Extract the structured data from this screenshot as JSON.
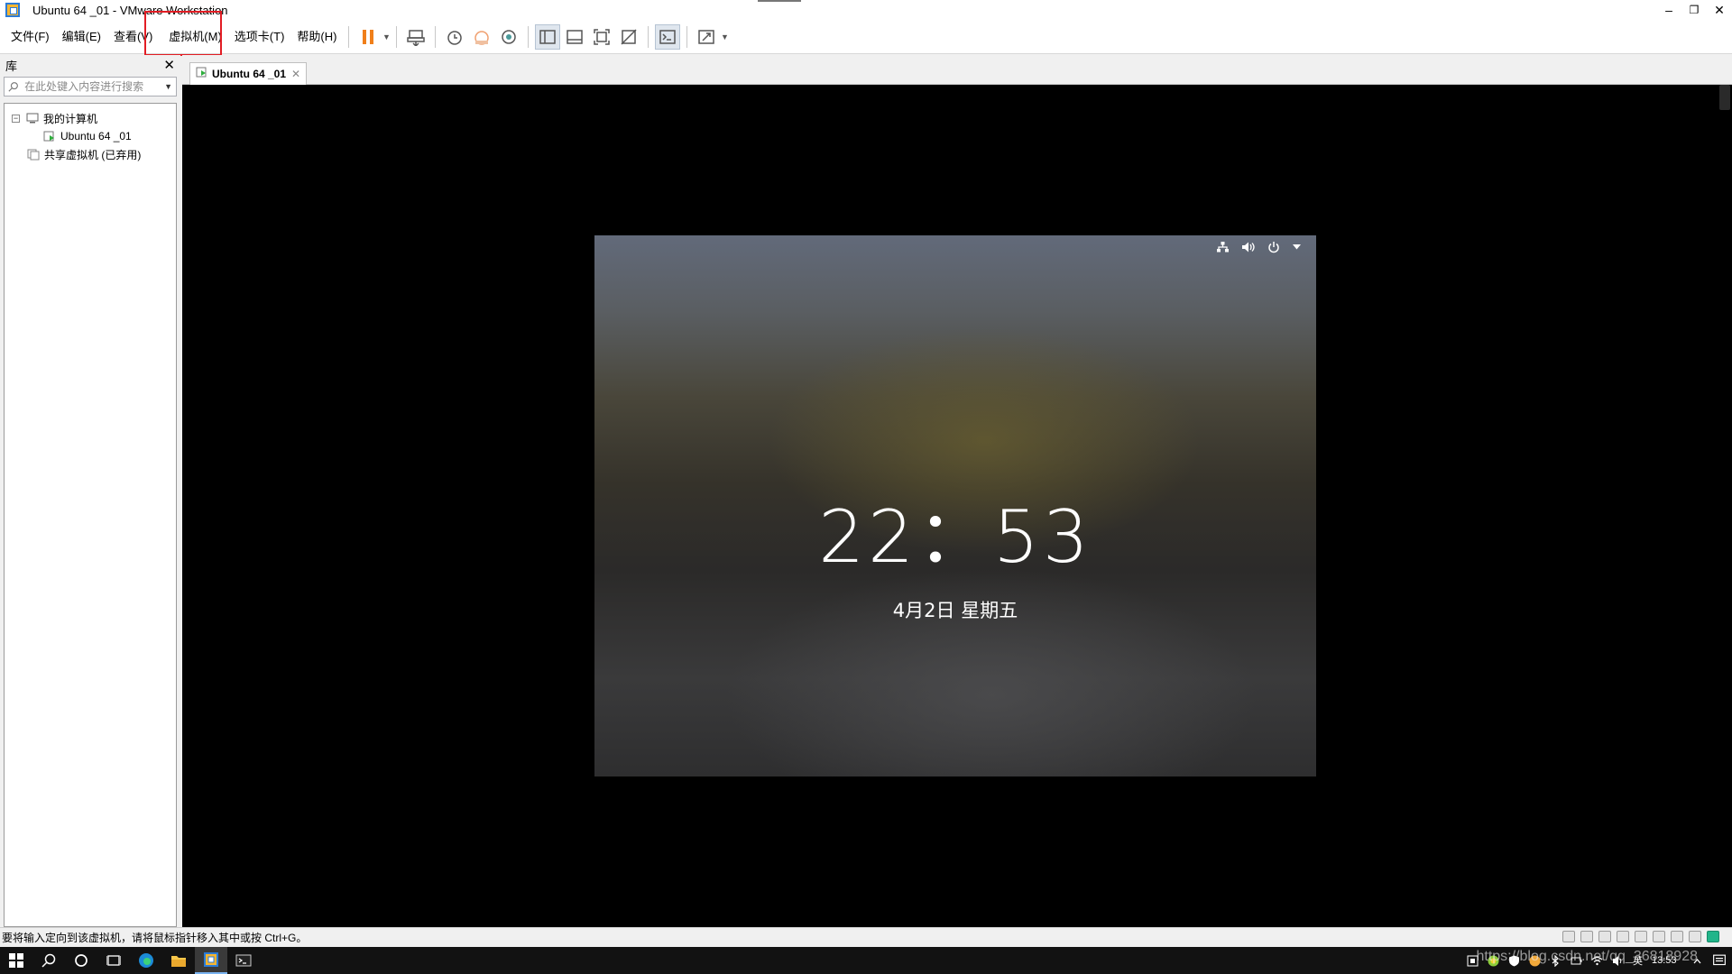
{
  "window": {
    "title": "Ubuntu 64 _01 - VMware Workstation",
    "controls": [
      "–",
      "❐",
      "✕"
    ]
  },
  "menu": {
    "items": [
      "文件(F)",
      "编辑(E)",
      "查看(V)",
      "虚拟机(M)",
      "选项卡(T)",
      "帮助(H)"
    ],
    "highlighted": "虚拟机(M)"
  },
  "library": {
    "title": "库",
    "close": "✕",
    "search_placeholder": "在此处键入内容进行搜索",
    "tree": {
      "expander": "−",
      "my_computer": "我的计算机",
      "vm": "Ubuntu 64 _01",
      "shared": "共享虚拟机 (已弃用)"
    }
  },
  "tab": {
    "label": "Ubuntu 64 _01",
    "close": "✕"
  },
  "guest": {
    "clock": "22：53",
    "date": "4月2日 星期五"
  },
  "status": {
    "text": "要将输入定向到该虚拟机，请将鼠标指针移入其中或按 Ctrl+G。"
  },
  "taskbar": {
    "tray_text": "英",
    "time": "13:53"
  },
  "watermark": "https://blog.csdn.net/qq_36818928",
  "colors": {
    "highlight": "#e21d24",
    "pause": "#f07f1a",
    "accent": "#2b7bd6"
  }
}
